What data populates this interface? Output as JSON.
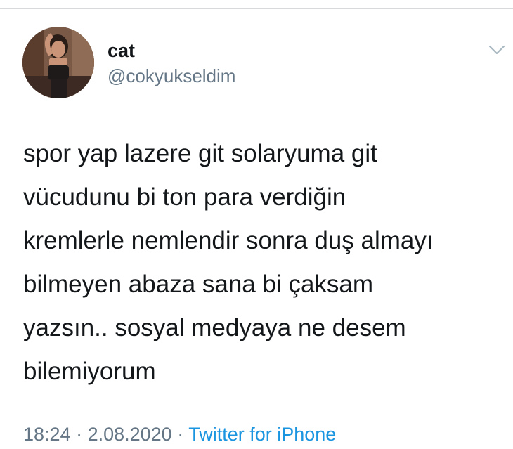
{
  "author": {
    "name": "cat",
    "handle": "@cokyukseldim"
  },
  "tweet": {
    "lines": [
      "spor yap lazere git solaryuma git",
      "vücudunu bi ton para verdiğin",
      "kremlerle nemlendir sonra duş almayı",
      "bilmeyen abaza sana bi çaksam",
      "yazsın.. sosyal medyaya ne desem",
      "bilemiyorum"
    ]
  },
  "meta": {
    "time": "18:24",
    "separator": " · ",
    "date": "2.08.2020",
    "source": "Twitter for iPhone"
  },
  "icons": {
    "menu": "chevron-down-icon"
  },
  "colors": {
    "text": "#14171a",
    "secondary": "#657786",
    "link": "#1b95e0"
  }
}
